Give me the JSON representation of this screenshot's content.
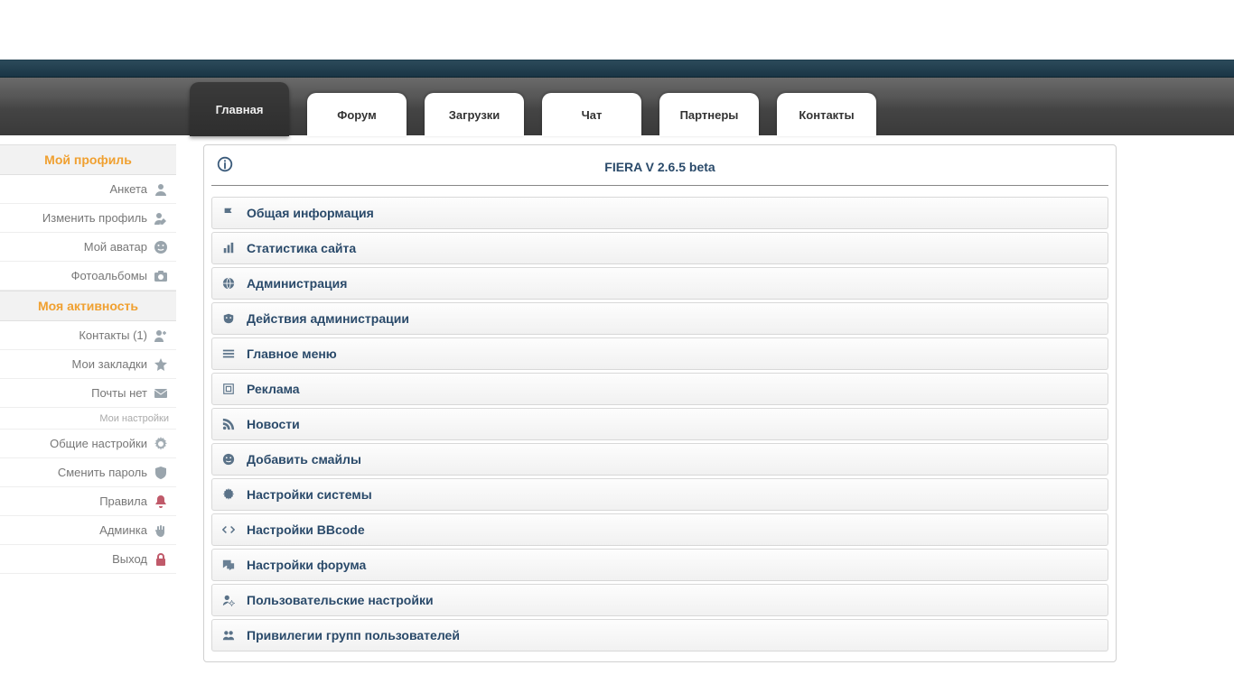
{
  "nav": {
    "tabs": [
      {
        "label": "Главная",
        "active": true
      },
      {
        "label": "Форум",
        "active": false
      },
      {
        "label": "Загрузки",
        "active": false
      },
      {
        "label": "Чат",
        "active": false
      },
      {
        "label": "Партнеры",
        "active": false
      },
      {
        "label": "Контакты",
        "active": false
      }
    ]
  },
  "sidebar": {
    "section1_title": "Мой профиль",
    "items1": [
      {
        "label": "Анкета",
        "icon": "user"
      },
      {
        "label": "Изменить профиль",
        "icon": "user-edit"
      },
      {
        "label": "Мой аватар",
        "icon": "smile"
      },
      {
        "label": "Фотоальбомы",
        "icon": "camera"
      }
    ],
    "section2_title": "Моя активность",
    "items2": [
      {
        "label": "Контакты (1)",
        "icon": "user-plus"
      },
      {
        "label": "Мои закладки",
        "icon": "star"
      },
      {
        "label": "Почты нет",
        "icon": "mail"
      }
    ],
    "section3_title": "Мои настройки",
    "items3": [
      {
        "label": "Общие настройки",
        "icon": "gear"
      },
      {
        "label": "Сменить пароль",
        "icon": "shield"
      },
      {
        "label": "Правила",
        "icon": "bell"
      },
      {
        "label": "Админка",
        "icon": "hand"
      },
      {
        "label": "Выход",
        "icon": "lock"
      }
    ]
  },
  "panel": {
    "title": "FIERA V 2.6.5 beta",
    "items": [
      {
        "label": "Общая информация",
        "icon": "flag"
      },
      {
        "label": "Статистика сайта",
        "icon": "bars"
      },
      {
        "label": "Администрация",
        "icon": "globe"
      },
      {
        "label": "Действия администрации",
        "icon": "mask"
      },
      {
        "label": "Главное меню",
        "icon": "menu"
      },
      {
        "label": "Реклама",
        "icon": "target"
      },
      {
        "label": "Новости",
        "icon": "rss"
      },
      {
        "label": "Добавить смайлы",
        "icon": "smile"
      },
      {
        "label": "Настройки системы",
        "icon": "gear"
      },
      {
        "label": "Настройки BBcode",
        "icon": "code"
      },
      {
        "label": "Настройки форума",
        "icon": "chat"
      },
      {
        "label": "Пользовательские настройки",
        "icon": "user-gear"
      },
      {
        "label": "Привилегии групп пользователей",
        "icon": "group"
      }
    ]
  }
}
